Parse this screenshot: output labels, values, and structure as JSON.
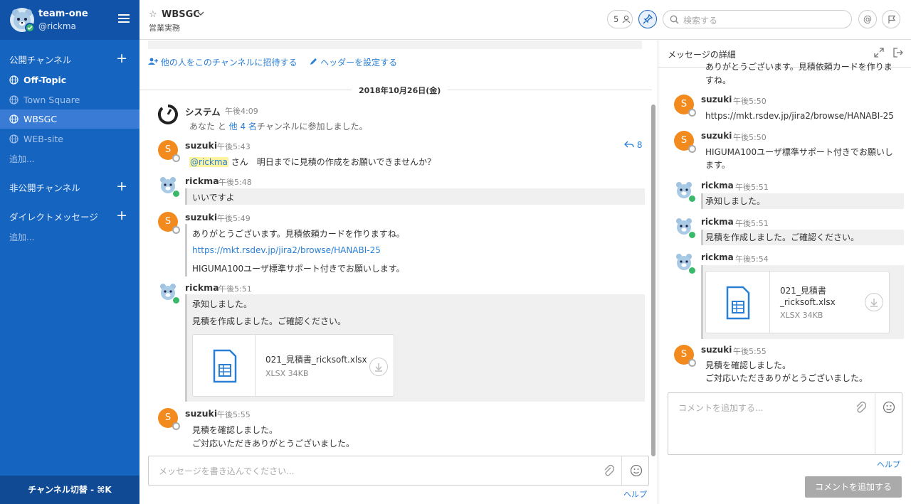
{
  "sidebar": {
    "team_name": "team-one",
    "user_handle": "@rickma",
    "public_header": "公開チャンネル",
    "public_channels": [
      {
        "label": "Off-Topic",
        "bold": true,
        "active": false
      },
      {
        "label": "Town Square",
        "bold": false,
        "active": false
      },
      {
        "label": "WBSGC",
        "bold": false,
        "active": true
      },
      {
        "label": "WEB-site",
        "bold": false,
        "active": false
      }
    ],
    "public_more": "追加...",
    "private_header": "非公開チャンネル",
    "dm_header": "ダイレクトメッセージ",
    "dm_more": "追加...",
    "switcher": "チャンネル切替 - ⌘K"
  },
  "header": {
    "channel_name": "WBSGC",
    "purpose": "営業実務",
    "member_count": "5",
    "search_placeholder": "検索する",
    "at_label": "@"
  },
  "center": {
    "invite_link": "他の人をこのチャンネルに招待する",
    "set_header_link": "ヘッダーを設定する",
    "date_separator": "2018年10月26日(金)",
    "posts": [
      {
        "user": "システム",
        "time": "午後4:09",
        "lines": [
          "あなた と 他 4 名チャンネルに参加しました。"
        ]
      },
      {
        "user": "suzuki",
        "time": "午後5:43",
        "mention": "@rickma",
        "text": "さん　明日までに見積の作成をお願いできませんか？",
        "reply_count": "8"
      },
      {
        "user": "rickma",
        "time": "午後5:48",
        "lines": [
          "いいですよ"
        ]
      },
      {
        "user": "suzuki",
        "time": "午後5:49",
        "lines": [
          "ありがとうございます。見積依頼カードを作りますね。",
          "https://mkt.rsdev.jp/jira2/browse/HANABI-25",
          "HIGUMA100ユーザ標準サポート付きでお願いします。"
        ]
      },
      {
        "user": "rickma",
        "time": "午後5:51",
        "lines": [
          "承知しました。",
          "見積を作成しました。ご確認ください。"
        ],
        "file": {
          "name": "021_見積書_ricksoft.xlsx",
          "size": "XLSX 34KB"
        }
      },
      {
        "user": "suzuki",
        "time": "午後5:55",
        "lines": [
          "見積を確認しました。",
          "ご対応いただきありがとうございました。"
        ]
      }
    ],
    "system_text_a": "あなた と ",
    "system_text_b": "他 4 名",
    "system_text_c": "チャンネルに参加しました。",
    "input_placeholder": "メッセージを書き込んでください...",
    "help": "ヘルプ"
  },
  "rhs": {
    "title": "メッセージの詳細",
    "top_clip": "ありがとうございます。見積依頼カードを作りま",
    "top_clip2": "すね。",
    "posts": [
      {
        "user": "suzuki",
        "time": "午後5:50",
        "lines": [
          "https://mkt.rsdev.jp/jira2/browse/HANABI-25"
        ]
      },
      {
        "user": "suzuki",
        "time": "午後5:50",
        "lines": [
          "HIGUMA100ユーザ標準サポート付きでお願いし",
          "ます。"
        ]
      },
      {
        "user": "rickma",
        "time": "午後5:51",
        "lines": [
          "承知しました。"
        ]
      },
      {
        "user": "rickma",
        "time": "午後5:51",
        "lines": [
          "見積を作成しました。ご確認ください。"
        ]
      },
      {
        "user": "rickma",
        "time": "午後5:54",
        "file": {
          "name1": "021_見積書",
          "name2": "_ricksoft.xlsx",
          "size": "XLSX 34KB"
        }
      },
      {
        "user": "suzuki",
        "time": "午後5:55",
        "lines": [
          "見積を確認しました。",
          "ご対応いただきありがとうございました。"
        ]
      }
    ],
    "input_placeholder": "コメントを追加する...",
    "help": "ヘルプ",
    "submit": "コメントを追加する"
  },
  "colors": {
    "sidebar": "#1565c0",
    "accent": "#2a7fd5",
    "suzuki_avatar": "#f28a1e",
    "online": "#3ab96a"
  }
}
